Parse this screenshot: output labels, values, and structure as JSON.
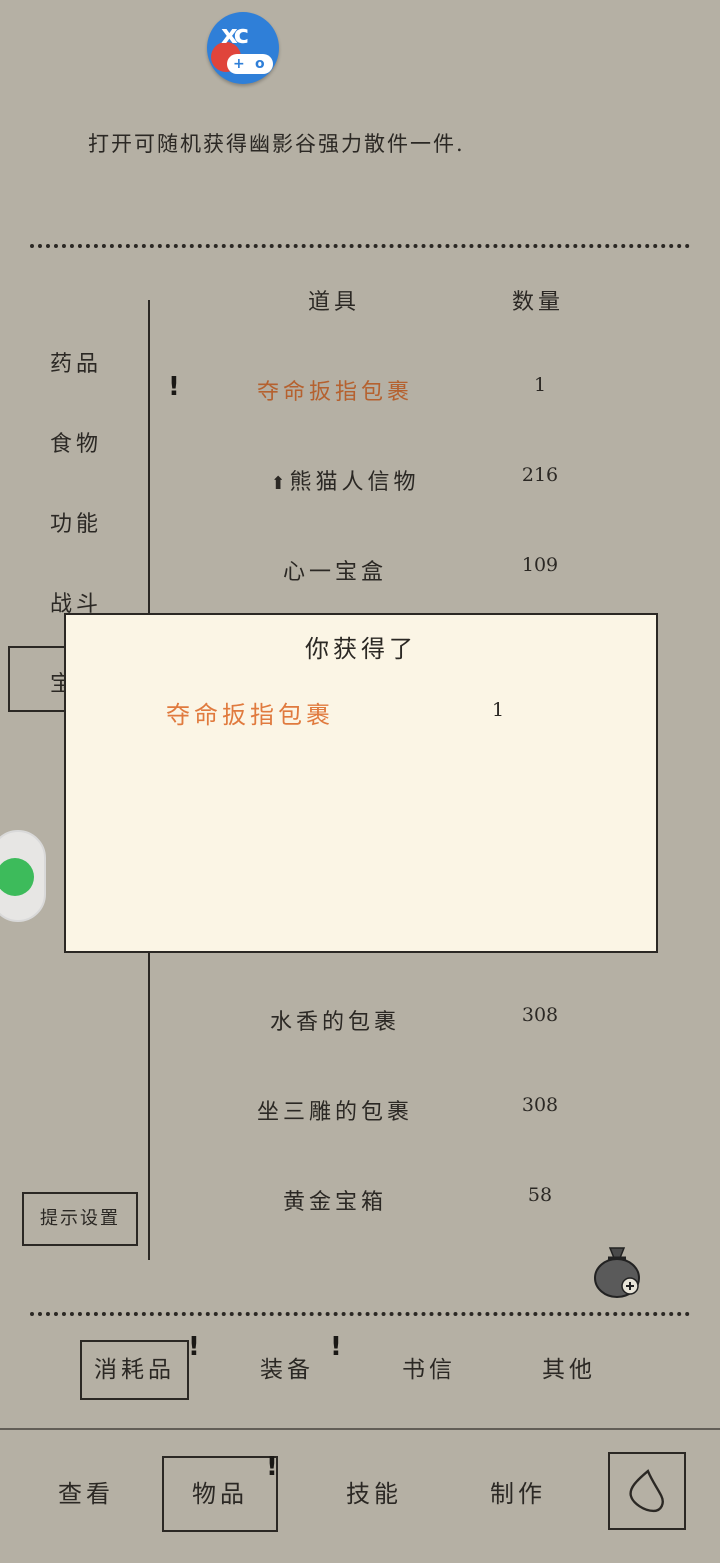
{
  "description": "打开可随机获得幽影谷强力散件一件.",
  "side_categories": [
    "药品",
    "食物",
    "功能",
    "战斗",
    "宝"
  ],
  "columns": {
    "item": "道具",
    "qty": "数量"
  },
  "items": [
    {
      "name": "夺命扳指包裹",
      "qty": "1",
      "highlight": true,
      "new": true
    },
    {
      "name": "熊猫人信物",
      "qty": "216",
      "upgrade": true
    },
    {
      "name": "心一宝盒",
      "qty": "109"
    },
    {
      "name": "水香的包裹",
      "qty": "308"
    },
    {
      "name": "坐三雕的包裹",
      "qty": "308"
    },
    {
      "name": "黄金宝箱",
      "qty": "58"
    }
  ],
  "hint_settings_label": "提示设置",
  "dialog": {
    "title": "你获得了",
    "item_name": "夺命扳指包裹",
    "item_qty": "1"
  },
  "tabs": [
    "消耗品",
    "装备",
    "书信",
    "其他"
  ],
  "nav": [
    "查看",
    "物品",
    "技能",
    "制作"
  ],
  "alert_mark": "!",
  "upgrade_mark": "⬆",
  "colors": {
    "background": "#b5b0a4",
    "dialog_bg": "#fbf5e5",
    "highlight": "#b5612f",
    "dialog_item": "#e07a3e"
  }
}
